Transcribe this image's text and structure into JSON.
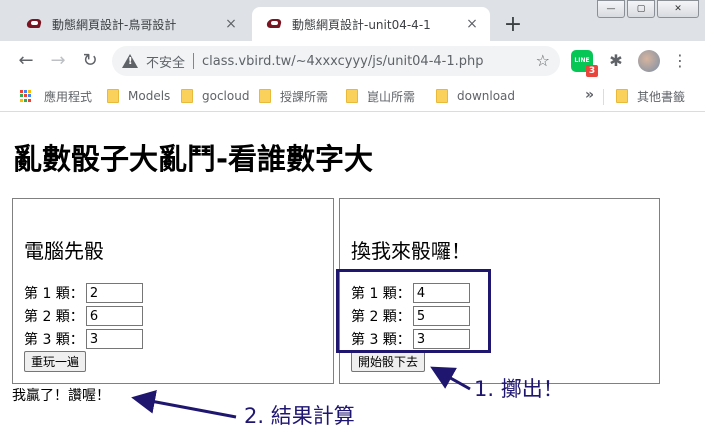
{
  "browser": {
    "tabs": [
      {
        "title": "動態網頁設計-鳥哥設計",
        "close": "×",
        "active": false
      },
      {
        "title": "動態網頁設計-unit04-4-1",
        "close": "×",
        "active": true
      }
    ],
    "new_tab": "+",
    "window_buttons": {
      "minimize": "—",
      "maximize": "▢",
      "close": "✕"
    },
    "nav": {
      "back": "←",
      "forward": "→",
      "reload": "↻"
    },
    "security_label": "不安全",
    "url": "class.vbird.tw/~4xxxcyyy/js/unit04-4-1.php",
    "bookmark_star": "☆",
    "extensions": {
      "line_label": "LINE",
      "line_badge": "3",
      "puzzle": "✱",
      "menu": "⋮"
    },
    "bookmarks": [
      {
        "label": "應用程式",
        "icon": "apps-grid-icon"
      },
      {
        "label": "Models",
        "icon": "folder-icon"
      },
      {
        "label": "gocloud",
        "icon": "folder-icon"
      },
      {
        "label": "授課所需",
        "icon": "folder-icon"
      },
      {
        "label": "崑山所需",
        "icon": "folder-icon"
      },
      {
        "label": "download",
        "icon": "folder-icon"
      }
    ],
    "bookmarks_overflow": "»",
    "other_bookmarks": "其他書籤"
  },
  "page": {
    "title": "亂數骰子大亂鬥-看誰數字大",
    "computer_panel": {
      "heading": "電腦先骰",
      "dice": [
        {
          "label": "第 1 顆：",
          "value": "2"
        },
        {
          "label": "第 2 顆：",
          "value": "6"
        },
        {
          "label": "第 3 顆：",
          "value": "3"
        }
      ],
      "button": "重玩一遍"
    },
    "player_panel": {
      "heading": "換我來骰囉！",
      "dice": [
        {
          "label": "第 1 顆：",
          "value": "4"
        },
        {
          "label": "第 2 顆：",
          "value": "5"
        },
        {
          "label": "第 3 顆：",
          "value": "3"
        }
      ],
      "button": "開始骰下去"
    },
    "result": "我贏了！讚喔！"
  },
  "annotations": {
    "roll": "1. 擲出！",
    "result": "2. 結果計算",
    "color": "#1f1670"
  }
}
